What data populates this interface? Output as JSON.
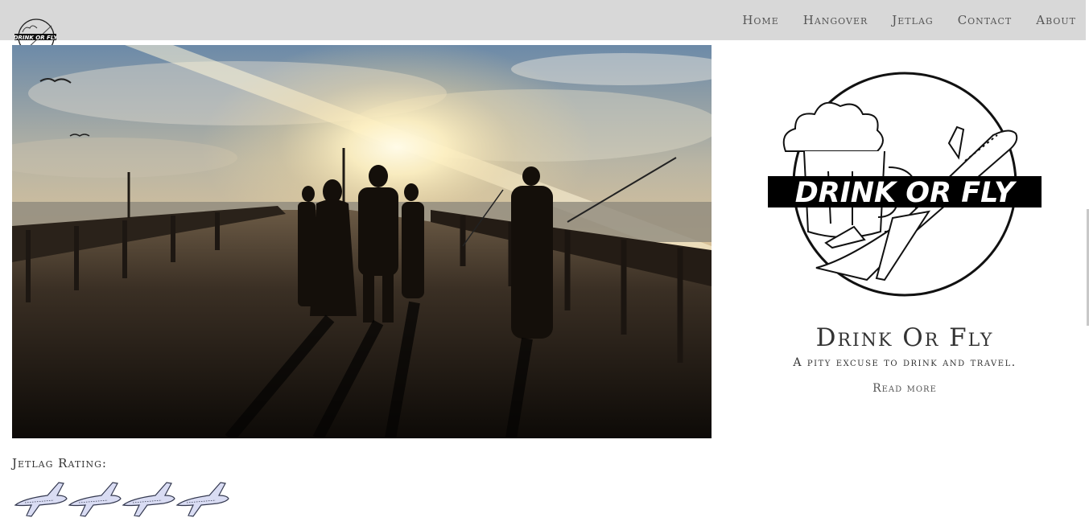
{
  "nav": {
    "items": [
      {
        "label": "Home"
      },
      {
        "label": "Hangover"
      },
      {
        "label": "Jetlag"
      },
      {
        "label": "Contact"
      },
      {
        "label": "About"
      }
    ]
  },
  "logo": {
    "text": "DRINK OR FLY"
  },
  "hero": {
    "alt_icon": "pier-sunset-photo"
  },
  "post": {
    "rating_label": "Jetlag Rating:",
    "rating_value": 4,
    "rating_icon": "airplane-icon"
  },
  "sidebar": {
    "logo_text": "DRINK OR FLY",
    "title": "Drink Or Fly",
    "tagline": "A pity excuse to drink and travel.",
    "read_more": "Read more"
  },
  "colors": {
    "topbar": "#d8d8d8",
    "text": "#333333",
    "plane_fill": "#d9dcf3"
  }
}
